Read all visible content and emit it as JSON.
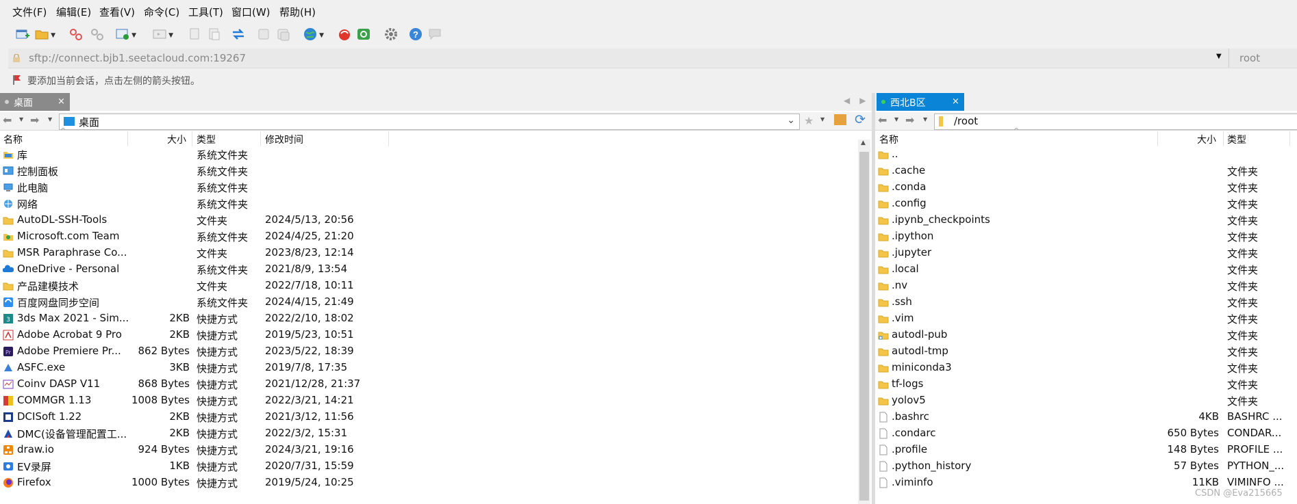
{
  "menu": [
    "文件(F)",
    "编辑(E)",
    "查看(V)",
    "命令(C)",
    "工具(T)",
    "窗口(W)",
    "帮助(H)"
  ],
  "address": {
    "url": "sftp://connect.bjb1.seetacloud.com:19267",
    "user": "root"
  },
  "notice": "要添加当前会话，点击左侧的箭头按钮。",
  "colors": {
    "tab_active": "#0a84d6",
    "folder": "#f3c64a",
    "accent": "#1e7bd6"
  },
  "left": {
    "tab_label": "桌面",
    "path": "桌面",
    "headers": {
      "name": "名称",
      "size": "大小",
      "type": "类型",
      "modified": "修改时间"
    },
    "rows": [
      {
        "name": "库",
        "size": "",
        "type": "系统文件夹",
        "modified": "",
        "icon": "library-icon"
      },
      {
        "name": "控制面板",
        "size": "",
        "type": "系统文件夹",
        "modified": "",
        "icon": "control-panel-icon"
      },
      {
        "name": "此电脑",
        "size": "",
        "type": "系统文件夹",
        "modified": "",
        "icon": "computer-icon"
      },
      {
        "name": "网络",
        "size": "",
        "type": "系统文件夹",
        "modified": "",
        "icon": "network-icon"
      },
      {
        "name": "AutoDL-SSH-Tools",
        "size": "",
        "type": "文件夹",
        "modified": "2024/5/13, 20:56",
        "icon": "folder-icon"
      },
      {
        "name": "Microsoft.com Team",
        "size": "",
        "type": "系统文件夹",
        "modified": "2024/4/25, 21:20",
        "icon": "user-folder-icon"
      },
      {
        "name": "MSR Paraphrase Co...",
        "size": "",
        "type": "文件夹",
        "modified": "2023/8/23, 12:14",
        "icon": "folder-icon"
      },
      {
        "name": "OneDrive - Personal",
        "size": "",
        "type": "系统文件夹",
        "modified": "2021/8/9, 13:54",
        "icon": "onedrive-icon"
      },
      {
        "name": "产品建模技术",
        "size": "",
        "type": "文件夹",
        "modified": "2022/7/18, 10:11",
        "icon": "folder-icon"
      },
      {
        "name": "百度网盘同步空间",
        "size": "",
        "type": "系统文件夹",
        "modified": "2024/4/15, 21:49",
        "icon": "baidu-sync-icon"
      },
      {
        "name": "3ds Max 2021 - Sim...",
        "size": "2KB",
        "type": "快捷方式",
        "modified": "2022/2/10, 18:02",
        "icon": "3dsmax-icon"
      },
      {
        "name": "Adobe Acrobat 9 Pro",
        "size": "2KB",
        "type": "快捷方式",
        "modified": "2019/5/23, 10:51",
        "icon": "acrobat-icon"
      },
      {
        "name": "Adobe Premiere Pr...",
        "size": "862 Bytes",
        "type": "快捷方式",
        "modified": "2023/5/22, 18:39",
        "icon": "premiere-icon"
      },
      {
        "name": "ASFC.exe",
        "size": "3KB",
        "type": "快捷方式",
        "modified": "2019/7/8, 17:35",
        "icon": "asfc-icon"
      },
      {
        "name": "Coinv DASP V11",
        "size": "868 Bytes",
        "type": "快捷方式",
        "modified": "2021/12/28, 21:37",
        "icon": "dasp-icon"
      },
      {
        "name": "COMMGR 1.13",
        "size": "1008 Bytes",
        "type": "快捷方式",
        "modified": "2022/3/21, 14:21",
        "icon": "commgr-icon"
      },
      {
        "name": "DCISoft 1.22",
        "size": "2KB",
        "type": "快捷方式",
        "modified": "2021/3/12, 11:56",
        "icon": "dcisoft-icon"
      },
      {
        "name": "DMC(设备管理配置工...",
        "size": "2KB",
        "type": "快捷方式",
        "modified": "2022/3/2, 15:31",
        "icon": "dmc-icon"
      },
      {
        "name": "draw.io",
        "size": "924 Bytes",
        "type": "快捷方式",
        "modified": "2024/3/21, 19:16",
        "icon": "drawio-icon"
      },
      {
        "name": "EV录屏",
        "size": "1KB",
        "type": "快捷方式",
        "modified": "2020/7/31, 15:59",
        "icon": "ev-icon"
      },
      {
        "name": "Firefox",
        "size": "1000 Bytes",
        "type": "快捷方式",
        "modified": "2019/5/24, 10:25",
        "icon": "firefox-icon"
      }
    ]
  },
  "right": {
    "tab_label": "西北B区",
    "path": "/root",
    "headers": {
      "name": "名称",
      "size": "大小",
      "type": "类型"
    },
    "rows": [
      {
        "name": "..",
        "size": "",
        "type": "",
        "icon": "folder-icon"
      },
      {
        "name": ".cache",
        "size": "",
        "type": "文件夹",
        "icon": "folder-icon"
      },
      {
        "name": ".conda",
        "size": "",
        "type": "文件夹",
        "icon": "folder-icon"
      },
      {
        "name": ".config",
        "size": "",
        "type": "文件夹",
        "icon": "folder-icon"
      },
      {
        "name": ".ipynb_checkpoints",
        "size": "",
        "type": "文件夹",
        "icon": "folder-icon"
      },
      {
        "name": ".ipython",
        "size": "",
        "type": "文件夹",
        "icon": "folder-icon"
      },
      {
        "name": ".jupyter",
        "size": "",
        "type": "文件夹",
        "icon": "folder-icon"
      },
      {
        "name": ".local",
        "size": "",
        "type": "文件夹",
        "icon": "folder-icon"
      },
      {
        "name": ".nv",
        "size": "",
        "type": "文件夹",
        "icon": "folder-icon"
      },
      {
        "name": ".ssh",
        "size": "",
        "type": "文件夹",
        "icon": "folder-icon"
      },
      {
        "name": ".vim",
        "size": "",
        "type": "文件夹",
        "icon": "folder-icon"
      },
      {
        "name": "autodl-pub",
        "size": "",
        "type": "文件夹",
        "icon": "link-folder-icon"
      },
      {
        "name": "autodl-tmp",
        "size": "",
        "type": "文件夹",
        "icon": "folder-icon"
      },
      {
        "name": "miniconda3",
        "size": "",
        "type": "文件夹",
        "icon": "folder-icon"
      },
      {
        "name": "tf-logs",
        "size": "",
        "type": "文件夹",
        "icon": "folder-icon"
      },
      {
        "name": "yolov5",
        "size": "",
        "type": "文件夹",
        "icon": "folder-icon"
      },
      {
        "name": ".bashrc",
        "size": "4KB",
        "type": "BASHRC ...",
        "icon": "file-icon"
      },
      {
        "name": ".condarc",
        "size": "650 Bytes",
        "type": "CONDAR...",
        "icon": "file-icon"
      },
      {
        "name": ".profile",
        "size": "148 Bytes",
        "type": "PROFILE ...",
        "icon": "file-icon"
      },
      {
        "name": ".python_history",
        "size": "57 Bytes",
        "type": "PYTHON_...",
        "icon": "file-icon"
      },
      {
        "name": ".viminfo",
        "size": "11KB",
        "type": "VIMINFO ...",
        "icon": "file-icon"
      }
    ]
  },
  "watermark": "CSDN @Eva215665"
}
